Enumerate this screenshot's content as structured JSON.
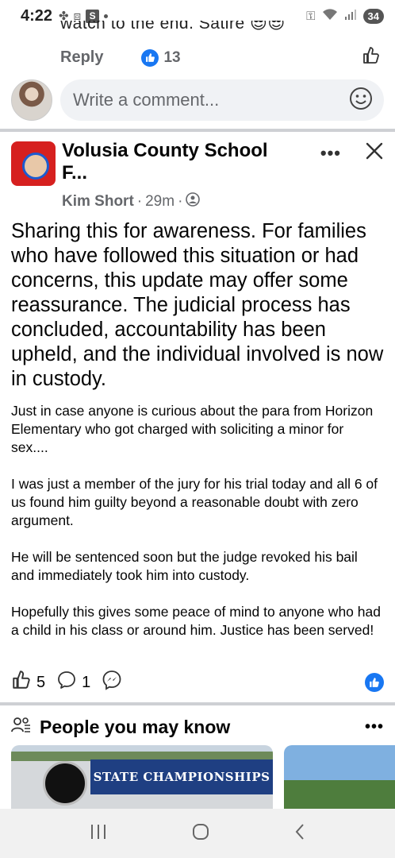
{
  "status_bar": {
    "time": "4:22",
    "s_badge": "S",
    "battery": "34",
    "signal_label": "5"
  },
  "prev_comment": {
    "cut_text": "watch to the end. Satire",
    "reply_label": "Reply",
    "reaction_count": "13"
  },
  "composer": {
    "placeholder": "Write a comment..."
  },
  "post": {
    "group_name": "Volusia County School F...",
    "poster_name": "Kim Short",
    "time_ago": "29m",
    "separator": "·",
    "text_large": "Sharing this for awareness. For families who have followed this situation or had concerns, this update may offer some reassurance. The judicial process has concluded, accountability has been upheld, and the individual involved is now in custody.",
    "paragraphs": [
      "Just in case anyone is curious about the para from Horizon Elementary who got charged with soliciting a minor for sex....",
      "I was just a member of the jury for his trial today and all 6 of us found him guilty beyond a reasonable doubt with zero argument.",
      "He will be sentenced soon but the judge revoked his bail and immediately took him into custody.",
      "Hopefully this gives some peace of mind to anyone who had a child in his class or around him. Justice has been served!"
    ],
    "like_count": "5",
    "comment_count": "1"
  },
  "pymk": {
    "title": "People you may know",
    "banner_text": "STATE CHAMPIONSHIPS"
  },
  "colors": {
    "fb_blue": "#1877f2",
    "divider": "#ced0d4",
    "secondary_text": "#65676b"
  }
}
